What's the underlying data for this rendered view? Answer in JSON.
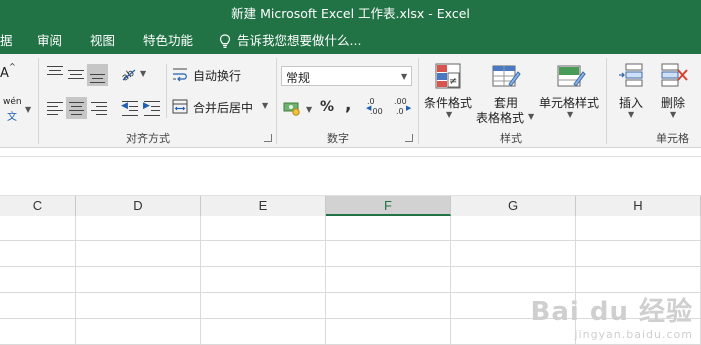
{
  "title": "新建 Microsoft Excel 工作表.xlsx - Excel",
  "tabs": [
    "据",
    "审阅",
    "视图",
    "特色功能"
  ],
  "tell_me": "告诉我您想要做什么...",
  "alignment": {
    "group_label": "对齐方式",
    "wrap_text": "自动换行",
    "merge_center": "合并后居中",
    "font_size_glyph": "A",
    "phonetic_glyph": "wén",
    "phonetic_sub": "文"
  },
  "number": {
    "group_label": "数字",
    "format_value": "常规",
    "percent": "%",
    "comma": ",",
    "inc_dec_top": ".0",
    "inc_dec_bottom": ".00",
    "dec_dec_top": ".00",
    "dec_dec_bottom": ".0"
  },
  "styles": {
    "group_label": "样式",
    "conditional": "条件格式",
    "table_line1": "套用",
    "table_line2": "表格格式",
    "cell_styles": "单元格样式"
  },
  "cells": {
    "group_label": "单元格",
    "insert": "插入",
    "delete": "删除"
  },
  "columns": [
    "C",
    "D",
    "E",
    "F",
    "G",
    "H"
  ],
  "selected_column": "F",
  "watermark": {
    "main": "Bai du 经验",
    "sub": "jingyan.baidu.com"
  },
  "colors": {
    "accent": "#217346",
    "ribbon": "#f3f3f3",
    "selected": "#c6c6c6"
  },
  "icons": [
    "lightbulb-icon",
    "wrap-text-icon",
    "merge-center-icon",
    "currency-icon",
    "conditional-format-icon",
    "format-table-icon",
    "cell-styles-icon",
    "insert-cells-icon",
    "delete-cells-icon"
  ]
}
